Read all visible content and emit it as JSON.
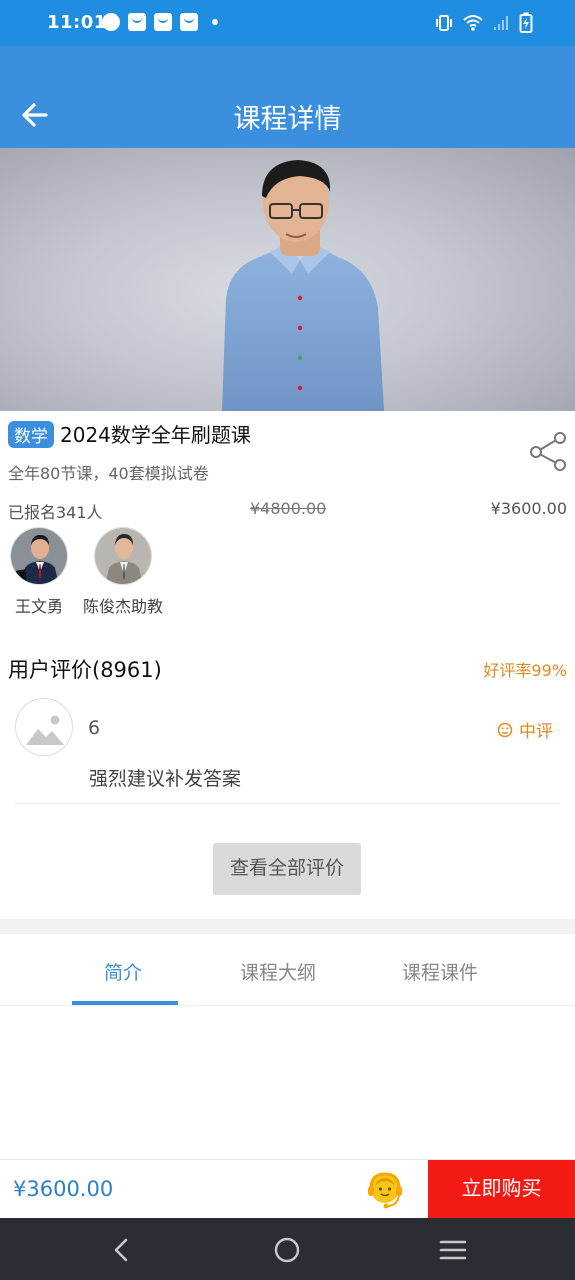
{
  "status_bar": {
    "time": "11:01",
    "icons": [
      "speedometer-icon",
      "shopping-bag-icon",
      "shopping-bag-icon",
      "shopping-bag-icon",
      "dot-icon",
      "vibrate-icon",
      "wifi-icon",
      "signal-icon",
      "battery-charging-icon"
    ]
  },
  "app_bar": {
    "title": "课程详情",
    "back_icon": "arrow-left-icon",
    "background": "#3b8fdd"
  },
  "course": {
    "tag": "数学",
    "title": "2024数学全年刷题课",
    "subtitle": "全年80节课，40套模拟试卷",
    "enrolled": "已报名341人",
    "original_price": "¥4800.00",
    "price": "¥3600.00",
    "share_icon": "share-icon"
  },
  "teachers": [
    {
      "name": "王文勇"
    },
    {
      "name": "陈俊杰助教"
    }
  ],
  "reviews": {
    "header": "用户评价(8961)",
    "good_rate": "好评率99%",
    "items": [
      {
        "user": "6",
        "rating": "中评",
        "text": "强烈建议补发答案"
      }
    ],
    "view_all_label": "查看全部评价"
  },
  "tabs": [
    {
      "label": "简介",
      "active": true
    },
    {
      "label": "课程大纲",
      "active": false
    },
    {
      "label": "课程课件",
      "active": false
    }
  ],
  "bottom_bar": {
    "price": "¥3600.00",
    "service_icon": "customer-service-icon",
    "buy_label": "立即购买"
  },
  "colors": {
    "accent": "#3b8fdd",
    "status_bar": "#1f8de0",
    "buy_button": "#f41a14",
    "rating": "#e08a1f"
  }
}
